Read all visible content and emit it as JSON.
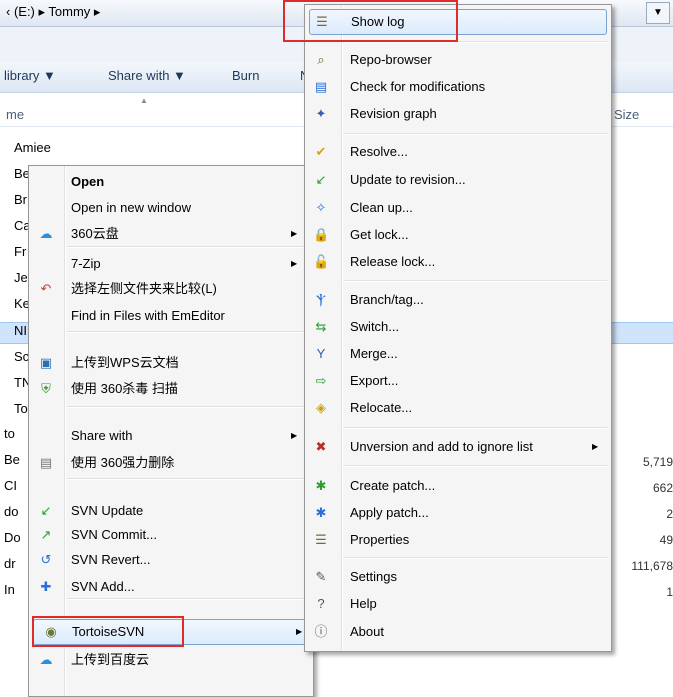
{
  "address": {
    "path": "‹ (E:) ▸ Tommy ▸",
    "dropdown": "▼"
  },
  "toolbar": {
    "library": "library ▼",
    "share": "Share with ▼",
    "burn": "Burn",
    "new_folder": "N"
  },
  "columns": {
    "name": "me",
    "size": "Size"
  },
  "files": [
    {
      "name": "Amiee"
    },
    {
      "name": "Be"
    },
    {
      "name": "Br"
    },
    {
      "name": "Ca"
    },
    {
      "name": "Fr"
    },
    {
      "name": "Je"
    },
    {
      "name": "Ke"
    },
    {
      "name": "NI"
    },
    {
      "name": "Sc"
    },
    {
      "name": "TN"
    },
    {
      "name": "To"
    },
    {
      "name": "to"
    },
    {
      "name": "Be"
    },
    {
      "name": "CI"
    },
    {
      "name": "do"
    },
    {
      "name": "Do"
    },
    {
      "name": "dr"
    },
    {
      "name": "In"
    }
  ],
  "sizes": [
    "5,719",
    "662",
    "2",
    "49",
    "111,678",
    "1"
  ],
  "left_menu": {
    "items": [
      {
        "label": "Open",
        "icon": ""
      },
      {
        "label": "Open in new window",
        "icon": ""
      },
      {
        "label": "360云盘",
        "icon": "cloud-icon"
      },
      {
        "label": "7-Zip",
        "icon": ""
      },
      {
        "label": "选择左侧文件夹来比较(L)",
        "icon": "compare-arrow-icon"
      },
      {
        "label": "Find in Files with EmEditor",
        "icon": ""
      },
      {
        "label": "上传到WPS云文档",
        "icon": "wps-cloud-icon"
      },
      {
        "label": "使用 360杀毒 扫描",
        "icon": "shield-icon"
      },
      {
        "label": "Share with",
        "icon": ""
      },
      {
        "label": "使用 360强力删除",
        "icon": "shredder-icon"
      },
      {
        "label": "SVN Update",
        "icon": "svn-update-icon"
      },
      {
        "label": "SVN Commit...",
        "icon": "svn-commit-icon"
      },
      {
        "label": "SVN Revert...",
        "icon": "svn-revert-icon"
      },
      {
        "label": "SVN Add...",
        "icon": "svn-add-icon"
      },
      {
        "label": "TortoiseSVN",
        "icon": "tortoise-icon"
      },
      {
        "label": "上传到百度云",
        "icon": "baidu-cloud-icon"
      }
    ]
  },
  "right_menu": {
    "items": [
      {
        "label": "Show log",
        "icon": "log-icon"
      },
      {
        "label": "Repo-browser",
        "icon": "repo-browser-icon"
      },
      {
        "label": "Check for modifications",
        "icon": "check-modifications-icon"
      },
      {
        "label": "Revision graph",
        "icon": "revision-graph-icon"
      },
      {
        "label": "Resolve...",
        "icon": "resolve-icon"
      },
      {
        "label": "Update to revision...",
        "icon": "update-revision-icon"
      },
      {
        "label": "Clean up...",
        "icon": "cleanup-icon"
      },
      {
        "label": "Get lock...",
        "icon": "lock-icon"
      },
      {
        "label": "Release lock...",
        "icon": "unlock-icon"
      },
      {
        "label": "Branch/tag...",
        "icon": "branch-icon"
      },
      {
        "label": "Switch...",
        "icon": "switch-icon"
      },
      {
        "label": "Merge...",
        "icon": "merge-icon"
      },
      {
        "label": "Export...",
        "icon": "export-icon"
      },
      {
        "label": "Relocate...",
        "icon": "relocate-icon"
      },
      {
        "label": "Unversion and add to ignore list",
        "icon": "ignore-icon"
      },
      {
        "label": "Create patch...",
        "icon": "create-patch-icon"
      },
      {
        "label": "Apply patch...",
        "icon": "apply-patch-icon"
      },
      {
        "label": "Properties",
        "icon": "properties-icon"
      },
      {
        "label": "Settings",
        "icon": "settings-icon"
      },
      {
        "label": "Help",
        "icon": "help-icon"
      },
      {
        "label": "About",
        "icon": "about-icon"
      }
    ]
  },
  "colors": {
    "highlight": "#cfe3fa",
    "annotation": "#e02b2b",
    "menu_bg": "#f5f5f5"
  }
}
